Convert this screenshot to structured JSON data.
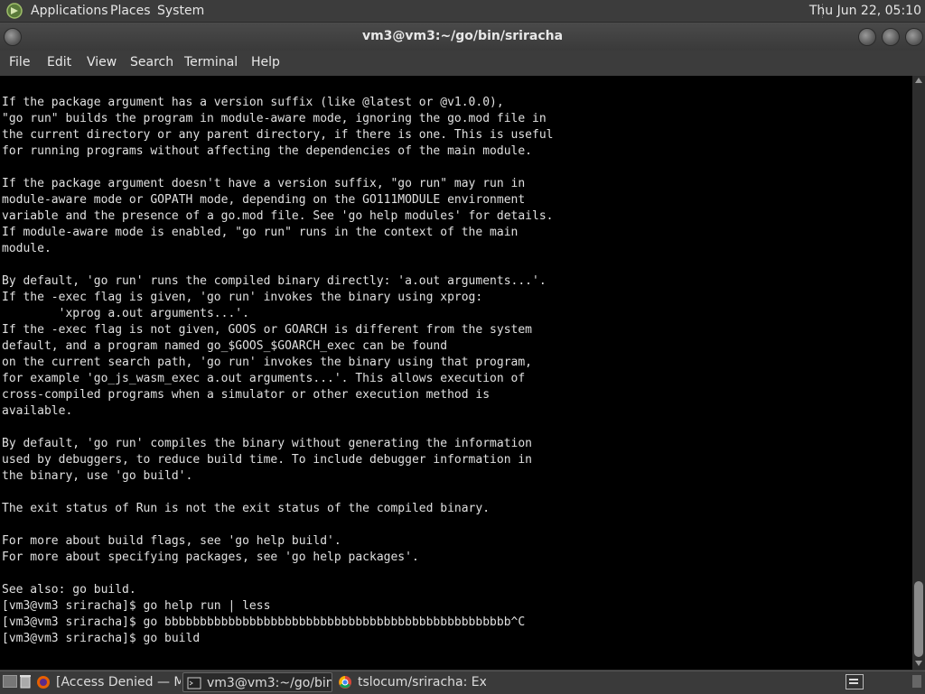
{
  "top_panel": {
    "menus": [
      "Applications",
      "Places",
      "System"
    ],
    "clock": "Thu Jun 22, 05:10"
  },
  "window": {
    "title": "vm3@vm3:~/go/bin/sriracha"
  },
  "menubar": [
    "File",
    "Edit",
    "View",
    "Search",
    "Terminal",
    "Help"
  ],
  "terminal": {
    "lines": [
      "If the package argument has a version suffix (like @latest or @v1.0.0),",
      "\"go run\" builds the program in module-aware mode, ignoring the go.mod file in",
      "the current directory or any parent directory, if there is one. This is useful",
      "for running programs without affecting the dependencies of the main module.",
      "",
      "If the package argument doesn't have a version suffix, \"go run\" may run in",
      "module-aware mode or GOPATH mode, depending on the GO111MODULE environment",
      "variable and the presence of a go.mod file. See 'go help modules' for details.",
      "If module-aware mode is enabled, \"go run\" runs in the context of the main",
      "module.",
      "",
      "By default, 'go run' runs the compiled binary directly: 'a.out arguments...'.",
      "If the -exec flag is given, 'go run' invokes the binary using xprog:",
      "        'xprog a.out arguments...'.",
      "If the -exec flag is not given, GOOS or GOARCH is different from the system",
      "default, and a program named go_$GOOS_$GOARCH_exec can be found",
      "on the current search path, 'go run' invokes the binary using that program,",
      "for example 'go_js_wasm_exec a.out arguments...'. This allows execution of",
      "cross-compiled programs when a simulator or other execution method is",
      "available.",
      "",
      "By default, 'go run' compiles the binary without generating the information",
      "used by debuggers, to reduce build time. To include debugger information in",
      "the binary, use 'go build'.",
      "",
      "The exit status of Run is not the exit status of the compiled binary.",
      "",
      "For more about build flags, see 'go help build'.",
      "For more about specifying packages, see 'go help packages'.",
      "",
      "See also: go build.",
      "[vm3@vm3 sriracha]$ go help run | less",
      "[vm3@vm3 sriracha]$ go bbbbbbbbbbbbbbbbbbbbbbbbbbbbbbbbbbbbbbbbbbbbbbbbb^C",
      "[vm3@vm3 sriracha]$ go build"
    ]
  },
  "taskbar": {
    "tasks": [
      {
        "label": "[Access Denied — M...",
        "icon": "firefox-icon",
        "active": false
      },
      {
        "label": "vm3@vm3:~/go/bin...",
        "icon": "terminal-icon",
        "active": true
      },
      {
        "label": "tslocum/sriracha: Ex...",
        "icon": "chrome-icon",
        "active": false
      }
    ]
  },
  "colors": {
    "panel_bg": "#3c3c3c",
    "terminal_bg": "#000000",
    "terminal_fg": "#e0e0e0"
  }
}
